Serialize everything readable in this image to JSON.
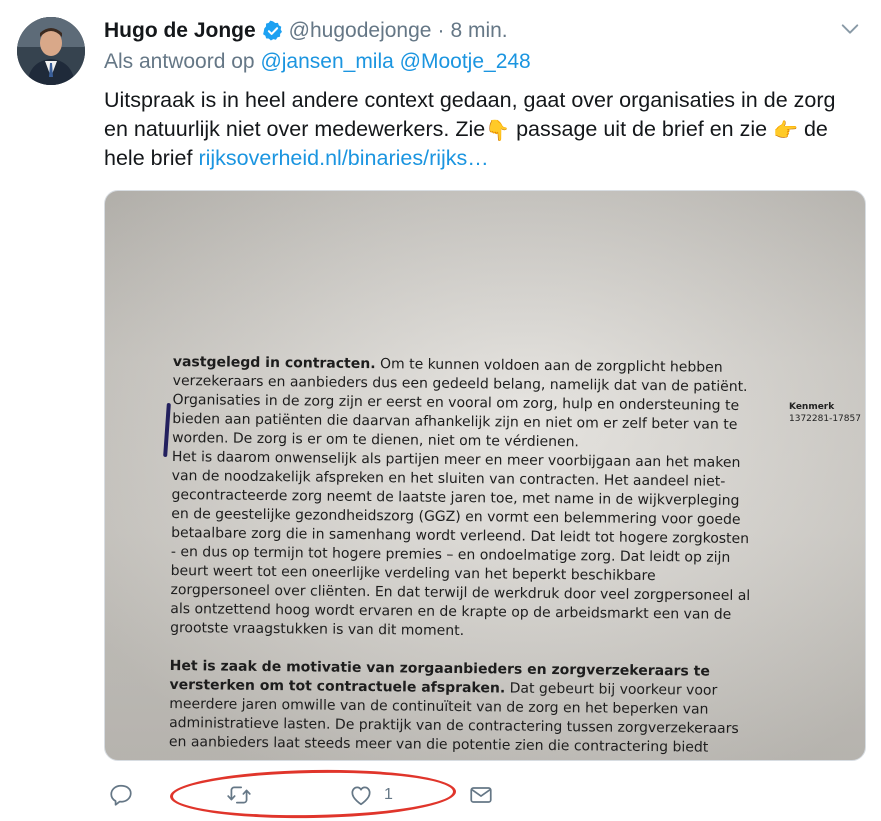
{
  "tweet": {
    "author_name": "Hugo de Jonge",
    "handle": "@hugodejonge",
    "separator": "·",
    "time": "8 min.",
    "reply_prefix": "Als antwoord op",
    "reply_mentions": [
      "@jansen_mila",
      "@Mootje_248"
    ],
    "text_part1": "Uitspraak is in heel andere context gedaan, gaat over organisaties in de zorg en natuurlijk niet over medewerkers. Zie",
    "emoji_down": "👇",
    "text_part2": "passage uit de brief en zie",
    "emoji_right": "👉",
    "text_part3": "de hele brief",
    "link": "rijksoverheid.nl/binaries/rijks…"
  },
  "media": {
    "kenmerk_label": "Kenmerk",
    "kenmerk_value": "1372281-17857",
    "para1_bold": "vastgelegd in contracten.",
    "para1_lines": [
      "Om te kunnen voldoen aan de zorgplicht hebben",
      "verzekeraars en aanbieders dus een gedeeld belang, namelijk dat van de patiënt.",
      "Organisaties in de zorg zijn er eerst en vooral om zorg, hulp en ondersteuning te",
      "bieden aan patiënten die daarvan afhankelijk zijn en niet om er zelf beter van te",
      "worden. De zorg is er om te dienen, niet om te vérdienen.",
      "Het is daarom onwenselijk als partijen meer en meer voorbijgaan aan het maken",
      "van de noodzakelijk afspreken en het sluiten van contracten.  Het aandeel niet-",
      "gecontracteerde zorg neemt de laatste jaren toe, met name in de wijkverpleging",
      "en de geestelijke gezondheidszorg (GGZ) en vormt een belemmering voor goede",
      "betaalbare zorg die in samenhang wordt verleend. Dat leidt tot hogere zorgkosten",
      "- en dus op termijn tot hogere premies – en ondoelmatige zorg. Dat leidt op zijn",
      "beurt weert tot een oneerlijke verdeling van het beperkt beschikbare",
      "zorgpersoneel over cliënten. En dat terwijl de werkdruk door veel zorgpersoneel al",
      "als ontzettend hoog wordt ervaren en de krapte op de arbeidsmarkt een van de",
      "grootste vraagstukken is van dit moment."
    ],
    "para2_bold_line1": "Het is zaak de motivatie van zorgaanbieders en zorgverzekeraars te",
    "para2_bold_line2": "versterken om tot contractuele afspraken.",
    "para2_line2_rest": "Dat gebeurt bij voorkeur voor",
    "para2_lines": [
      "meerdere jaren omwille van de continuïteit van de zorg en het beperken van",
      "administratieve lasten. De praktijk van de contractering tussen zorgverzekeraars",
      "en aanbieders laat steeds meer van die potentie zien die contractering biedt"
    ]
  },
  "actions": {
    "reply_icon": "reply-icon",
    "retweet_icon": "retweet-icon",
    "like_icon": "heart-icon",
    "like_count": "1",
    "dm_icon": "envelope-icon"
  },
  "colors": {
    "link": "#1b95e0",
    "muted": "#657786",
    "annotation": "#e0352b"
  }
}
